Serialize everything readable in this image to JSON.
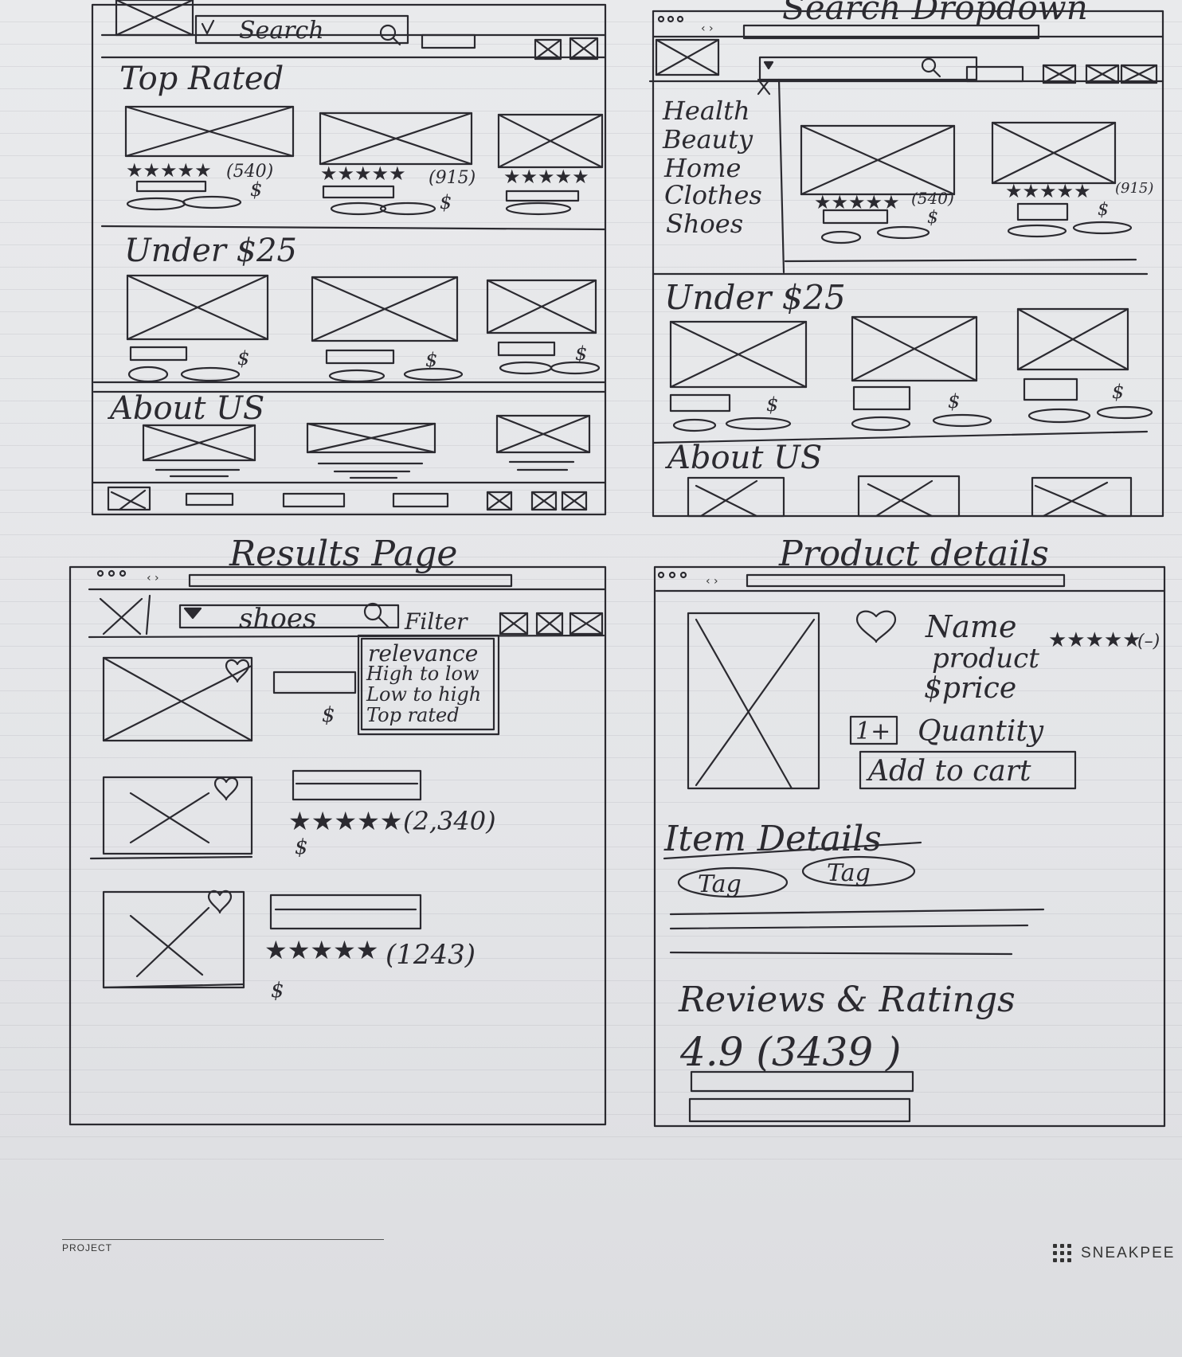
{
  "frames": {
    "home": {
      "search_label": "Search",
      "section_top_rated": "Top Rated",
      "top_rated_counts": [
        "(540)",
        "(915)"
      ],
      "section_under": "Under $25",
      "section_about": "About US"
    },
    "search_dropdown": {
      "title": "Search Dropdown",
      "categories": [
        "Health",
        "Beauty",
        "Home",
        "Clothes",
        "Shoes"
      ],
      "counts": [
        "(540)",
        "(915)"
      ],
      "section_under": "Under $25",
      "section_about": "About US"
    },
    "results": {
      "title": "Results Page",
      "search_value": "shoes",
      "filter_label": "Filter",
      "sort_options": [
        "relevance",
        "High to low",
        "Low to high",
        "Top rated"
      ],
      "review_counts": [
        "(2,340)",
        "(1243)"
      ],
      "price_symbol": "$"
    },
    "product": {
      "title": "Product details",
      "name": "Name",
      "rating": "(–)",
      "product_label": "product",
      "price": "$price",
      "quantity_control": "1+",
      "quantity_label": "Quantity",
      "add_to_cart": "Add to cart",
      "section_item_details": "Item Details",
      "tags": [
        "Tag",
        "Tag"
      ],
      "section_reviews": "Reviews & Ratings",
      "review_summary": "4.9 (3439 )"
    }
  },
  "footer": {
    "project_label": "PROJECT",
    "brand": "SNEAKPEE"
  }
}
